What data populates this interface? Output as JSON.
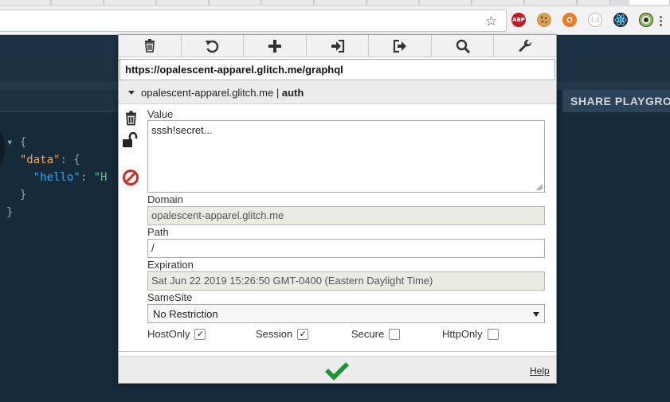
{
  "browser": {
    "extensions": [
      {
        "name": "adblock-plus",
        "label": "ABP",
        "color": "#c8171e"
      },
      {
        "name": "cookie",
        "label": "",
        "color": "#c99648"
      },
      {
        "name": "lifebuoy",
        "label": "",
        "color": "#f07b24"
      },
      {
        "name": "code",
        "label": "(..)",
        "color": "#9e9e9e"
      },
      {
        "name": "react",
        "label": "",
        "color": "#1d2a3a"
      },
      {
        "name": "color-picker",
        "label": "",
        "color": "#3a3a3a"
      }
    ]
  },
  "page": {
    "share_label": "SHARE PLAYGRO",
    "code_lines": [
      "▾ {",
      "  \"data\": {",
      "    \"hello\": \"H",
      "  }",
      "}"
    ]
  },
  "popup": {
    "toolbar": [
      {
        "name": "delete-all",
        "icon": "trash-icon"
      },
      {
        "name": "reset",
        "icon": "undo-icon"
      },
      {
        "name": "add",
        "icon": "plus-icon"
      },
      {
        "name": "import",
        "icon": "import-icon"
      },
      {
        "name": "export",
        "icon": "export-icon"
      },
      {
        "name": "search",
        "icon": "search-icon"
      },
      {
        "name": "options",
        "icon": "wrench-icon"
      }
    ],
    "url": "https://opalescent-apparel.glitch.me/graphql",
    "cookie_domain": "opalescent-apparel.glitch.me",
    "cookie_separator": "|",
    "cookie_name": "auth",
    "fields": {
      "value_label": "Value",
      "value": "sssh!secret...",
      "domain_label": "Domain",
      "domain": "opalescent-apparel.glitch.me",
      "path_label": "Path",
      "path": "/",
      "expiration_label": "Expiration",
      "expiration": "Sat Jun 22 2019 15:26:50 GMT-0400 (Eastern Daylight Time)",
      "samesite_label": "SameSite",
      "samesite": "No Restriction"
    },
    "flags": [
      {
        "label": "HostOnly",
        "checked": true
      },
      {
        "label": "Session",
        "checked": true
      },
      {
        "label": "Secure",
        "checked": false
      },
      {
        "label": "HttpOnly",
        "checked": false
      }
    ],
    "help_label": "Help",
    "colors": {
      "save": "#1e9632",
      "block": "#d52b1e",
      "accent": "#333333"
    }
  }
}
